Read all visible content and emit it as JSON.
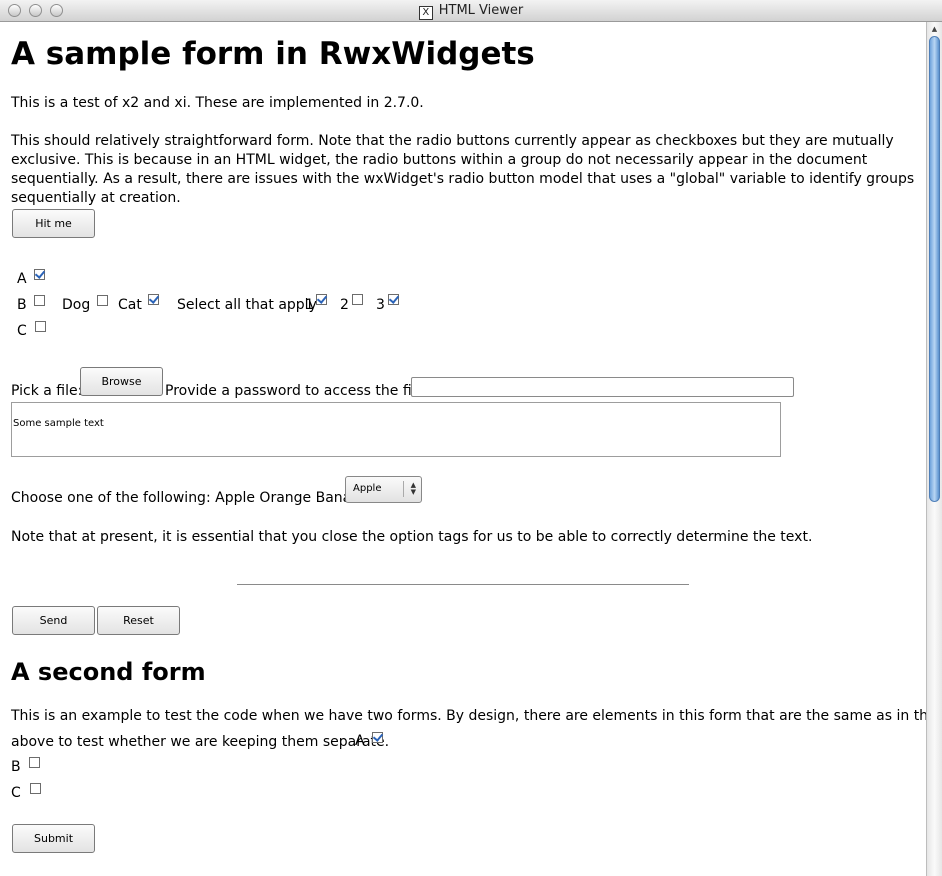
{
  "window": {
    "title": "HTML Viewer",
    "app_icon": "X"
  },
  "form1": {
    "heading": "A sample form in RwxWidgets",
    "intro": "This is a test of x2 and xi. These are implemented in 2.7.0.",
    "description": "This should relatively straightforward form. Note that the radio buttons currently appear as checkboxes but they are mutually exclusive. This is because in an HTML widget, the radio buttons within a group do not necessarily appear in the document sequentially. As a result, there are issues with the wxWidget's radio button model that uses a \"global\" variable to identify groups sequentially at creation.",
    "hit_button": "Hit me",
    "radios": [
      {
        "label": "A",
        "checked": true
      },
      {
        "label": "B",
        "checked": false
      },
      {
        "label": "C",
        "checked": false
      }
    ],
    "pets": [
      {
        "label": "Dog",
        "checked": false
      },
      {
        "label": "Cat",
        "checked": true
      }
    ],
    "select_all_label": "Select all that apply",
    "select_all": [
      {
        "label": "1",
        "checked": true
      },
      {
        "label": "2",
        "checked": false
      },
      {
        "label": "3",
        "checked": true
      }
    ],
    "file_label": "Pick a file:",
    "browse_button": "Browse",
    "password_label": "Provide a password to access the file:",
    "password_value": "",
    "textarea_value": "Some sample text",
    "choose_label": "Choose one of the following: Apple Orange Banana",
    "select_value": "Apple",
    "note": "Note that at present, it is essential that you close the option tags for us to be able to correctly determine the text.",
    "send_button": "Send",
    "reset_button": "Reset"
  },
  "form2": {
    "heading": "A second form",
    "line1": "This is an example to test the code when we have two forms. By design, there are elements in this form that are the same as in the form",
    "line2": "above to test whether we are keeping them separate.",
    "radios": [
      {
        "label": "A",
        "checked": true
      },
      {
        "label": "B",
        "checked": false
      },
      {
        "label": "C",
        "checked": false
      }
    ],
    "submit_button": "Submit"
  }
}
